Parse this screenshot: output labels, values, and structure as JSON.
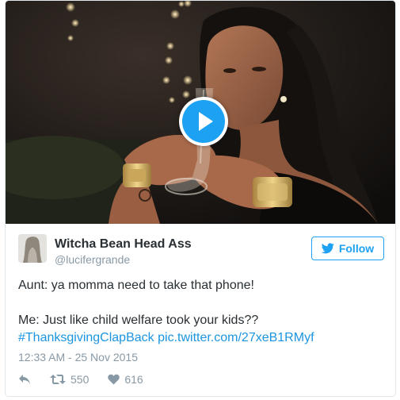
{
  "author": {
    "name": "Witcha Bean Head Ass",
    "handle": "@lucifergrande"
  },
  "follow_button": {
    "label": "Follow",
    "icon": "twitter-bird-icon"
  },
  "tweet": {
    "line1": "Aunt: ya momma need to take that phone!",
    "line2": "Me: Just like child welfare took your kids??",
    "hashtag": "#ThanksgivingClapBack",
    "link": "pic.twitter.com/27xeB1RMyf"
  },
  "timestamp": "12:33 AM - 25 Nov 2015",
  "actions": {
    "reply_icon": "reply-icon",
    "retweet_icon": "retweet-icon",
    "retweet_count": "550",
    "like_icon": "heart-icon",
    "like_count": "616"
  },
  "media": {
    "type": "video",
    "play_icon": "play-icon"
  },
  "colors": {
    "accent": "#1da1f2",
    "link": "#1b95e0",
    "text": "#292f33",
    "muted": "#8899a6",
    "border": "#e1e8ed"
  }
}
